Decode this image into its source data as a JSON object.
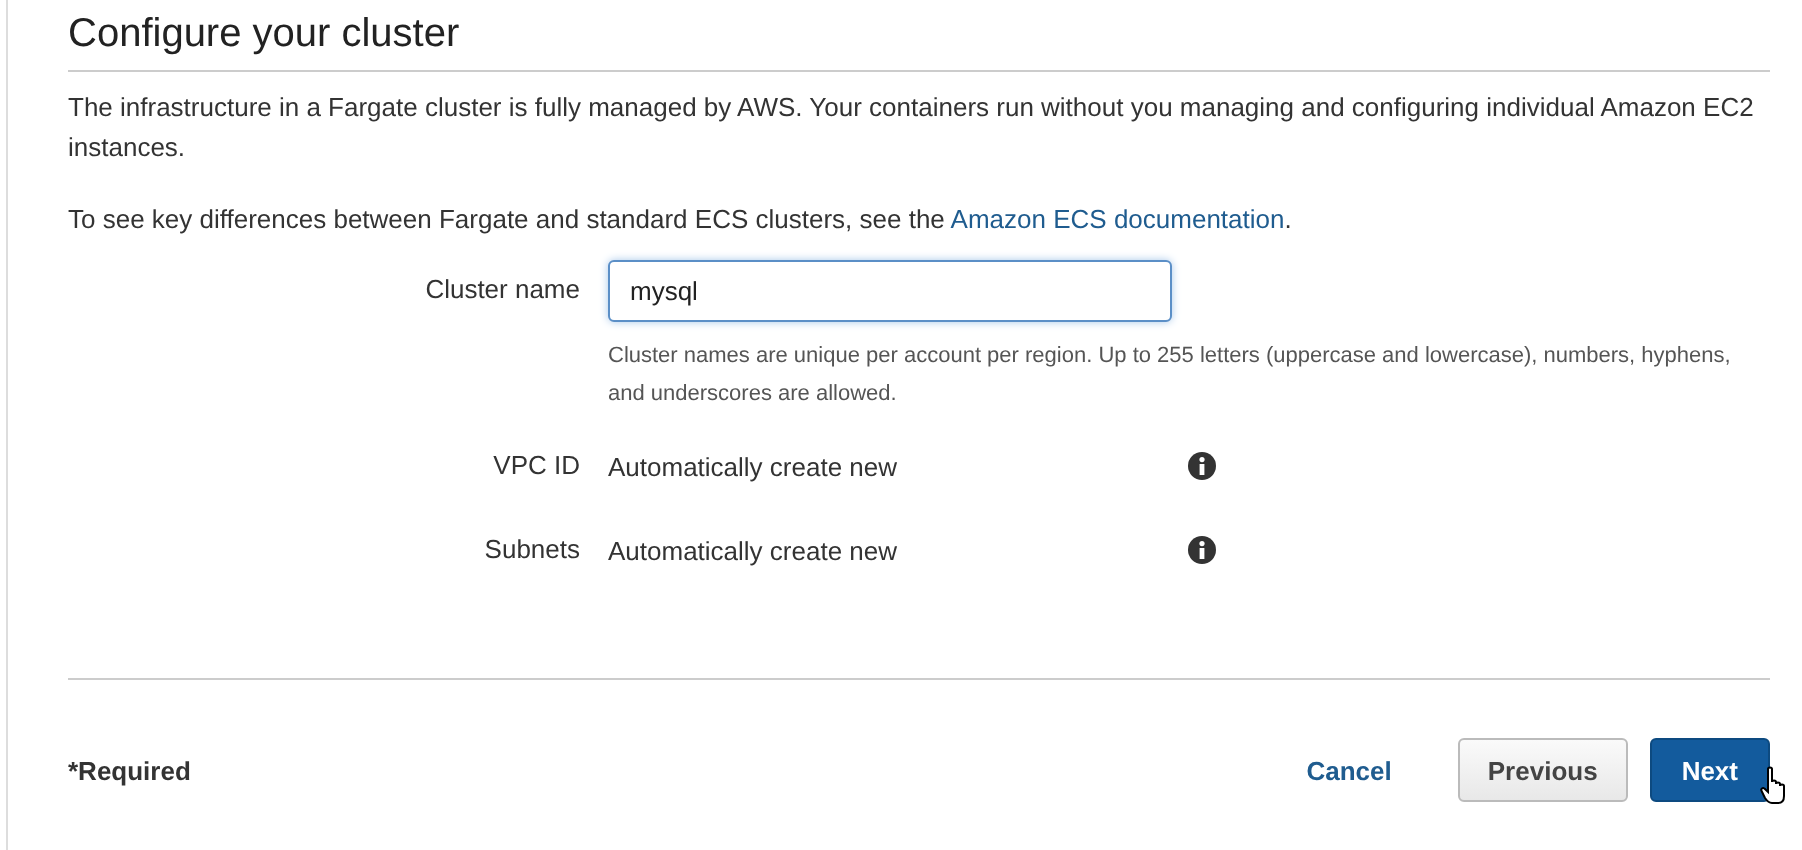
{
  "heading": "Configure your cluster",
  "intro": "The infrastructure in a Fargate cluster is fully managed by AWS. Your containers run without you managing and configuring individual Amazon EC2 instances.",
  "docs": {
    "text": "To see key differences between Fargate and standard ECS clusters, see the ",
    "link": "Amazon ECS documentation",
    "after": "."
  },
  "fields": [
    {
      "kind": "input",
      "label": "Cluster name",
      "value": "mysql",
      "focused": true,
      "help": "Cluster names are unique per account per region. Up to 255 letters (uppercase and lowercase), numbers, hyphens, and underscores are allowed."
    },
    {
      "kind": "static",
      "label": "VPC ID",
      "value": "Automatically create new",
      "info": true
    },
    {
      "kind": "static",
      "label": "Subnets",
      "value": "Automatically create new",
      "info": true
    }
  ],
  "required_note": "*Required",
  "buttons": [
    {
      "kind": "link",
      "label": "Cancel"
    },
    {
      "kind": "secondary",
      "label": "Previous"
    },
    {
      "kind": "primary",
      "label": "Next",
      "hovered": true
    }
  ]
}
